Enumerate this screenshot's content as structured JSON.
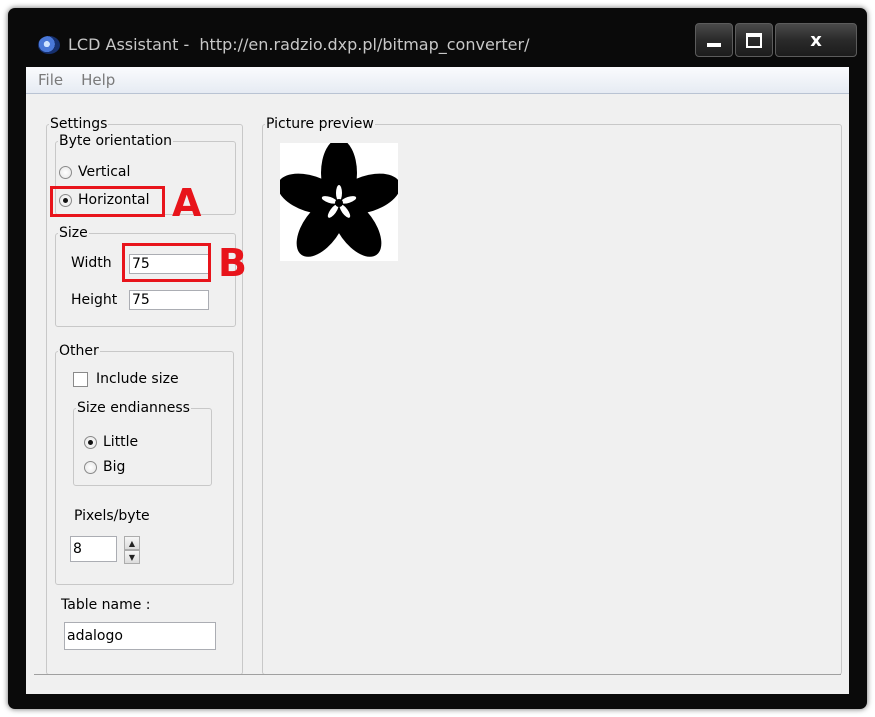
{
  "window": {
    "title": "LCD Assistant -  http://en.radzio.dxp.pl/bitmap_converter/",
    "close_glyph": "x"
  },
  "menu": [
    "File",
    "Help"
  ],
  "settings": {
    "legend": "Settings",
    "byte_orientation": {
      "legend": "Byte orientation",
      "options": [
        "Vertical",
        "Horizontal"
      ],
      "selected": "Horizontal"
    },
    "size": {
      "legend": "Size",
      "width_label": "Width",
      "width_value": "75",
      "height_label": "Height",
      "height_value": "75"
    },
    "other": {
      "legend": "Other",
      "include_size_label": "Include size",
      "include_size_checked": false,
      "endianness": {
        "legend": "Size endianness",
        "options": [
          "Little",
          "Big"
        ],
        "selected": "Little"
      },
      "pixels_per_byte_label": "Pixels/byte",
      "pixels_per_byte_value": "8"
    },
    "table_name_label": "Table name :",
    "table_name_value": "adalogo"
  },
  "preview": {
    "legend": "Picture preview",
    "image_icon": "flower-logo-icon"
  },
  "annotations": {
    "a": "A",
    "b": "B",
    "color": "#e8141b"
  }
}
